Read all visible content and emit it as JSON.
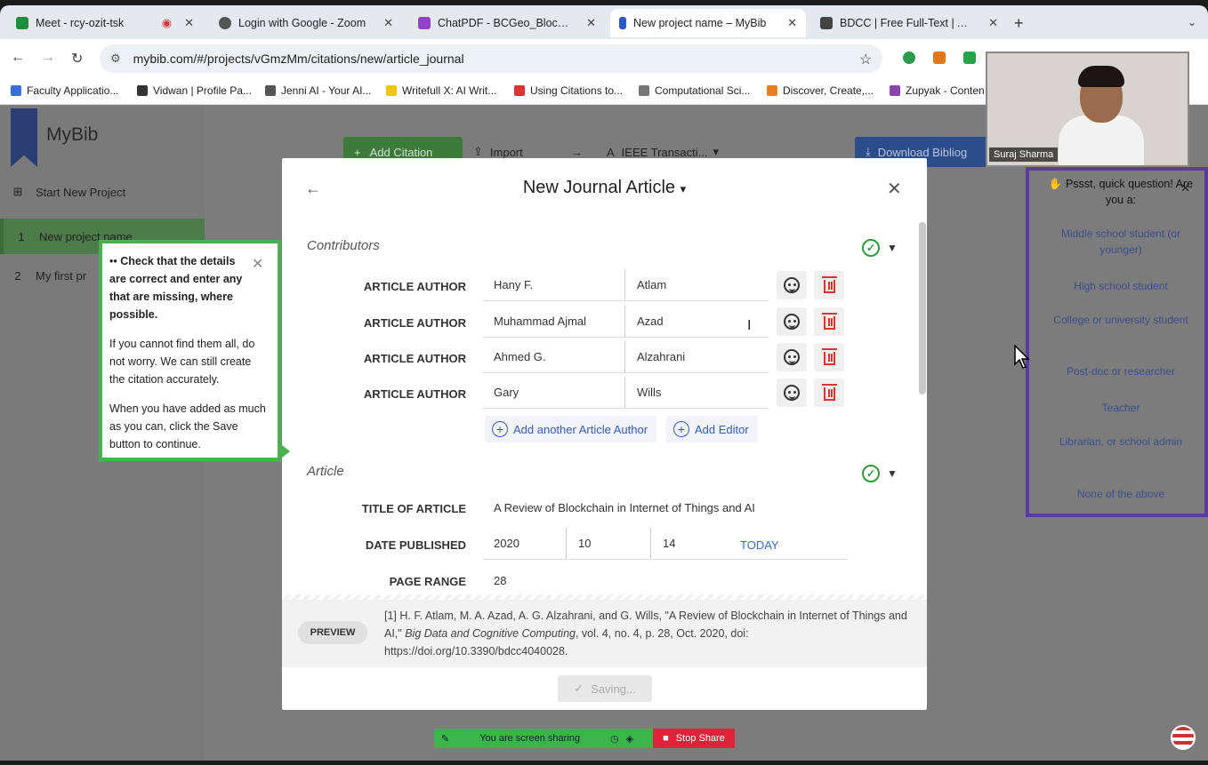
{
  "browser": {
    "tabs": [
      {
        "label": "Meet - rcy-ozit-tsk",
        "color": "#1e8e3e"
      },
      {
        "label": "Login with Google - Zoom",
        "color": "#555555"
      },
      {
        "label": "ChatPDF - BCGeo_Blockcha...",
        "color": "#8e44c4"
      },
      {
        "label": "New project name – MyBib",
        "color": "#2b59c3"
      },
      {
        "label": "BDCC | Free Full-Text | A Rev",
        "color": "#444444"
      }
    ],
    "url": "mybib.com/#/projects/vGmzMm/citations/new/article_journal",
    "bookmarks": [
      "Faculty Applicatio...",
      "Vidwan | Profile Pa...",
      "Jenni AI - Your AI...",
      "Writefull X: AI Writ...",
      "Using Citations to...",
      "Computational Sci...",
      "Discover, Create,...",
      "Zupyak - Conten"
    ]
  },
  "app": {
    "logo": "MyBib",
    "sidebar": [
      {
        "num": "",
        "label": "Start New Project"
      },
      {
        "num": "1",
        "label": "New project name"
      },
      {
        "num": "2",
        "label": "My first pr"
      }
    ],
    "toolbar": {
      "add_citation": "Add Citation",
      "import": "Import",
      "style": "IEEE Transacti...",
      "download": "Download Bibliog"
    }
  },
  "modal": {
    "title": "New Journal Article",
    "contributors_heading": "Contributors",
    "authors": [
      {
        "role": "ARTICLE AUTHOR",
        "first": "Hany F.",
        "last": "Atlam"
      },
      {
        "role": "ARTICLE AUTHOR",
        "first": "Muhammad Ajmal",
        "last": "Azad"
      },
      {
        "role": "ARTICLE AUTHOR",
        "first": "Ahmed G.",
        "last": "Alzahrani"
      },
      {
        "role": "ARTICLE AUTHOR",
        "first": "Gary",
        "last": "Wills"
      }
    ],
    "add_author": "Add another Article Author",
    "add_editor": "Add Editor",
    "article_heading": "Article",
    "title_label": "TITLE OF ARTICLE",
    "title_value": "A Review of Blockchain in Internet of Things and AI",
    "date_label": "DATE PUBLISHED",
    "date_year": "2020",
    "date_month": "10",
    "date_day": "14",
    "today": "TODAY",
    "page_label": "PAGE RANGE",
    "page_value": "28",
    "preview_btn": "PREVIEW",
    "preview_text_pre": "[1]   H. F. Atlam, M. A. Azad, A. G. Alzahrani, and G. Wills, \"A Review of Blockchain in Internet of Things and AI,\" ",
    "preview_text_journal": "Big Data and Cognitive Computing",
    "preview_text_post": ", vol. 4, no. 4, p. 28, Oct. 2020, doi: https://doi.org/10.3390/bdcc4040028.",
    "saving": "Saving..."
  },
  "tooltip": {
    "p1": "Check that the details are correct and enter any that are missing, where possible.",
    "p2": "If you cannot find them all, do not worry. We can still create the citation accurately.",
    "p3": "When you have added as much as you can, click the Save button to continue."
  },
  "survey": {
    "title": "Pssst, quick question! Are you a:",
    "options": [
      "Middle school student (or younger)",
      "High school student",
      "College or university student",
      "Post-doc or researcher",
      "Teacher",
      "Librarian, or school admin",
      "None of the above"
    ]
  },
  "video": {
    "name": "Suraj Sharma"
  },
  "sharebar": {
    "status": "You are screen sharing",
    "stop": "Stop Share"
  }
}
